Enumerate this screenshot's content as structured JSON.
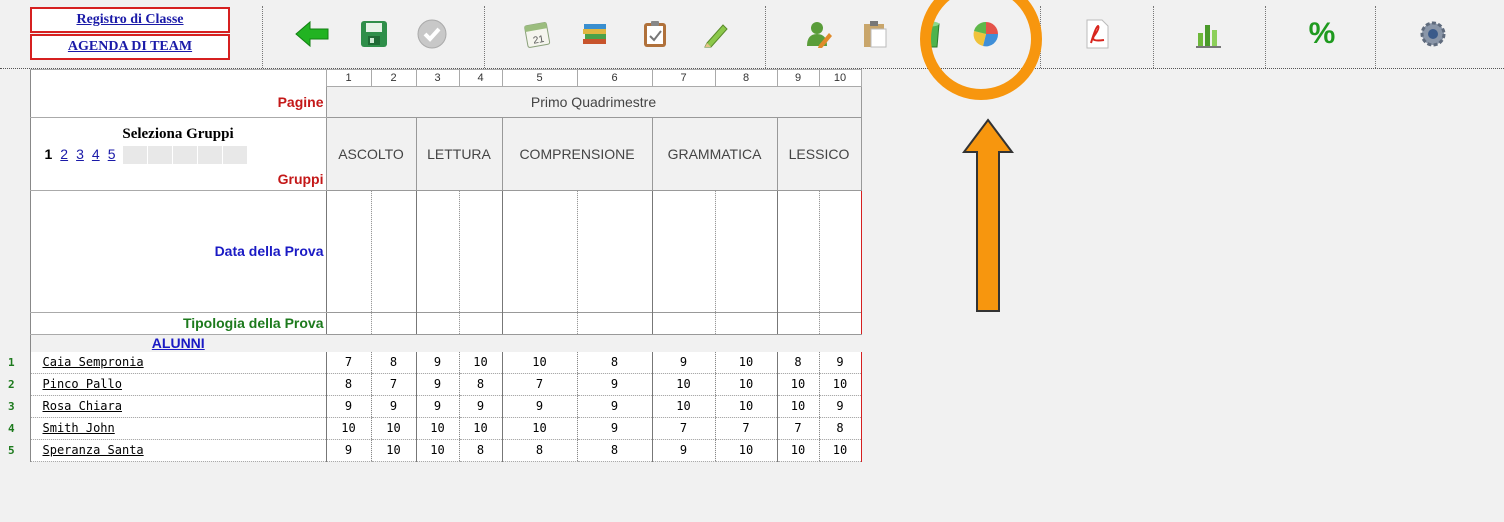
{
  "toolbar": {
    "registro_label": "Registro di Classe",
    "agenda_label": "AGENDA DI TEAM",
    "percent_symbol": "%"
  },
  "icons": [
    "back-arrow-icon",
    "save-disk-icon",
    "checkmark-icon",
    "calendar-icon",
    "books-icon",
    "clipboard-icon",
    "pencil-icon",
    "user-edit-icon",
    "paste-icon",
    "bucket-icon",
    "pie-chart-icon",
    "pdf-icon",
    "bar-chart-icon",
    "percent-icon",
    "settings-gear-icon"
  ],
  "colors": {
    "highlight": "#f7960e",
    "red_label": "#c41818",
    "blue_label": "#1a1ac4",
    "green_label": "#1d7a1d"
  },
  "grid": {
    "column_numbers": [
      "1",
      "2",
      "3",
      "4",
      "5",
      "6",
      "7",
      "8",
      "9",
      "10"
    ],
    "pagine_label": "Pagine",
    "quadrimestre": "Primo Quadrimestre",
    "seleziona_gruppi": "Seleziona Gruppi",
    "groups": [
      "1",
      "2",
      "3",
      "4",
      "5"
    ],
    "gruppi_label": "Gruppi",
    "categories": [
      "ASCOLTO",
      "LETTURA",
      "COMPRENSIONE",
      "GRAMMATICA",
      "LESSICO"
    ],
    "data_prova_label": "Data della Prova",
    "tipologia_label": "Tipologia della Prova",
    "alunni_label": "ALUNNI"
  },
  "students": [
    {
      "num": "1",
      "name": "Caia Sempronia",
      "scores": [
        "7",
        "8",
        "9",
        "10",
        "10",
        "8",
        "9",
        "10",
        "8",
        "9"
      ]
    },
    {
      "num": "2",
      "name": "Pinco Pallo",
      "scores": [
        "8",
        "7",
        "9",
        "8",
        "7",
        "9",
        "10",
        "10",
        "10",
        "10"
      ]
    },
    {
      "num": "3",
      "name": "Rosa Chiara",
      "scores": [
        "9",
        "9",
        "9",
        "9",
        "9",
        "9",
        "10",
        "10",
        "10",
        "9"
      ]
    },
    {
      "num": "4",
      "name": "Smith John",
      "scores": [
        "10",
        "10",
        "10",
        "10",
        "10",
        "9",
        "7",
        "7",
        "7",
        "8"
      ]
    },
    {
      "num": "5",
      "name": "Speranza Santa",
      "scores": [
        "9",
        "10",
        "10",
        "8",
        "8",
        "8",
        "9",
        "10",
        "10",
        "10"
      ]
    }
  ]
}
